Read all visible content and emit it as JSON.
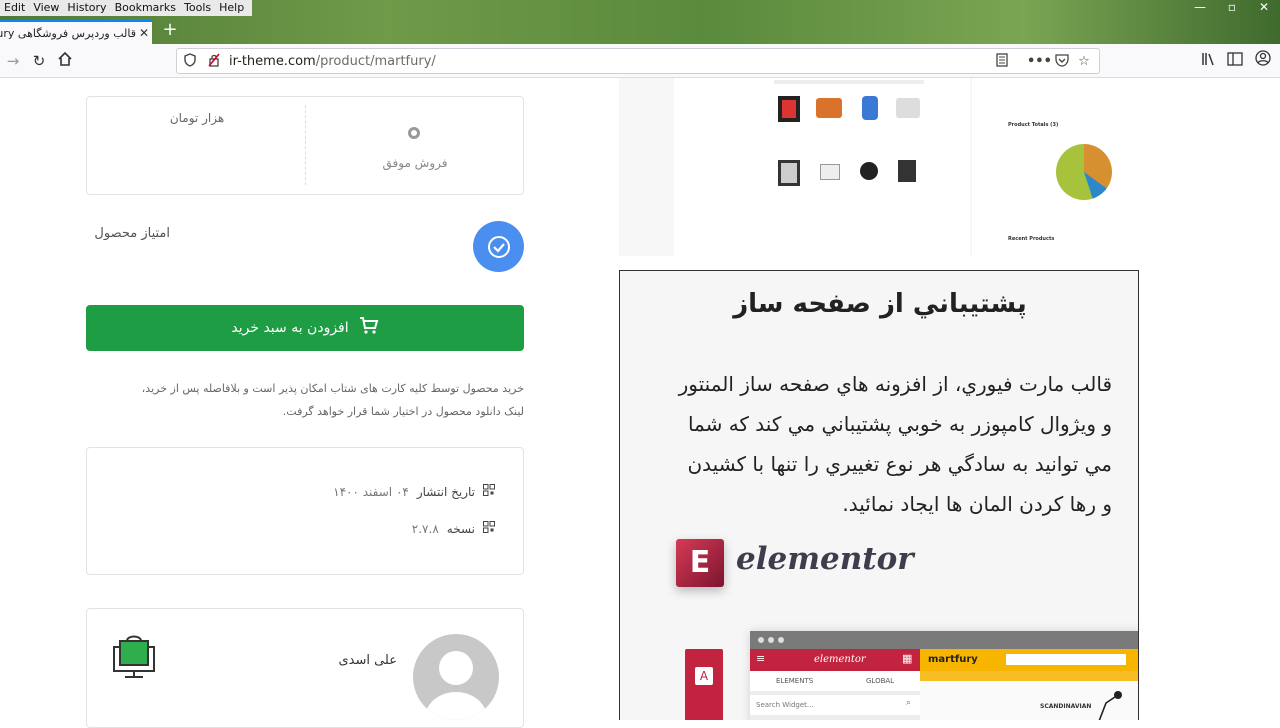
{
  "browser": {
    "menu": [
      "Edit",
      "View",
      "History",
      "Bookmarks",
      "Tools",
      "Help"
    ],
    "tab_title": "قالب وردپرس فروشگاهی MartFury",
    "url_host": "ir-theme.com",
    "url_path": "/product/martfury/"
  },
  "sales_box": {
    "price_unit": "هزار تومان",
    "success_label": "فروش موفق"
  },
  "rating_label": "امتیاز محصول",
  "cart_button": "افزودن به سبد خرید",
  "purchase_note": {
    "line1": "خرید محصول توسط کلیه کارت های شتاب امکان پذیر است و بلافاصله پس از خرید،",
    "line2": "لینک دانلود محصول در اختیار شما قرار خواهد گرفت."
  },
  "meta": {
    "publish_label": "تاریخ انتشار",
    "publish_value": "۰۴ اسفند ۱۴۰۰",
    "version_label": "نسخه",
    "version_value": "۲.۷.۸"
  },
  "author": {
    "name": "علی اسدی"
  },
  "feature": {
    "title": "پشتيباني از صفحه ساز",
    "line1": "قالب مارت فيوري، از افزونه هاي صفحه ساز المنتور",
    "line2": "و ويژوال كامپوزر به خوبي پشتيباني مي كند كه شما",
    "line3": "مي توانيد به سادگي هر نوع تغييري را تنها با كشيدن",
    "line4": "و رها كردن المان ها ايجاد نمائيد.",
    "brand": "elementor",
    "brand_mark": "E"
  },
  "editor_preview": {
    "logo": "elementor",
    "tab1": "ELEMENTS",
    "tab2": "GLOBAL",
    "search_placeholder": "Search Widget...",
    "site_logo": "martfury",
    "side_a": "A",
    "scandinavian": "SCANDINAVIAN"
  },
  "screenshot_preview": {
    "product_totals": "Product Totals (3)",
    "recent_products": "Recent Products"
  },
  "colors": {
    "cart_green": "#1f9d45",
    "check_blue": "#4a8ef0",
    "elementor_red": "#b5213f",
    "martfury_yellow": "#f7b500"
  }
}
